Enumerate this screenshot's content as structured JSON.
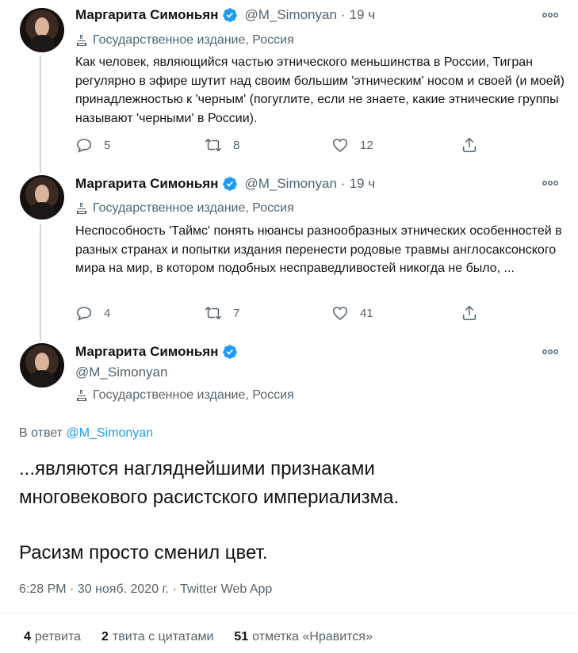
{
  "tweets": [
    {
      "name": "Маргарита Симоньян",
      "handle": "@M_Simonyan",
      "time": "19 ч",
      "label": "Государственное издание, Россия",
      "text": "Как человек, являющийся частью этнического меньшинства в России, Тигран регулярно в эфире шутит над своим большим 'этническим' носом и своей (и моей) принадлежностью к 'черным' (погуглите, если не знаете, какие этнические группы называют 'черными' в России).",
      "replies": "5",
      "retweets": "8",
      "likes": "12"
    },
    {
      "name": "Маргарита Симоньян",
      "handle": "@M_Simonyan",
      "time": "19 ч",
      "label": "Государственное издание, Россия",
      "text": "Неспособность 'Таймс' понять нюансы разнообразных этнических особенностей в разных странах и попытки издания перенести родовые травмы англосаксонского мира на мир, в котором подобных несправедливостей никогда не было, ...",
      "replies": "4",
      "retweets": "7",
      "likes": "41"
    }
  ],
  "main": {
    "name": "Маргарита Симоньян",
    "handle": "@M_Simonyan",
    "label": "Государственное издание, Россия",
    "reply_prefix": "В ответ",
    "reply_mention": "@M_Simonyan",
    "text_line1": "...являются нагляднейшими признаками",
    "text_line2": "многовекового расистского империализма.",
    "text_line3": "Расизм просто сменил цвет.",
    "timestamp": "6:28 PM · 30 нояб. 2020 г. · Twitter Web App",
    "stats": [
      {
        "count": "4",
        "label": "ретвита"
      },
      {
        "count": "2",
        "label": "твита с цитатами"
      },
      {
        "count": "51",
        "label": "отметка «Нравится»"
      }
    ]
  },
  "colors": {
    "accent": "#1d9bf0",
    "text": "#0f1419",
    "muted": "#536471",
    "divider": "#eff3f4"
  },
  "icons": [
    "verified-badge-icon",
    "more-icon",
    "government-icon",
    "reply-icon",
    "retweet-icon",
    "like-icon",
    "share-icon"
  ]
}
